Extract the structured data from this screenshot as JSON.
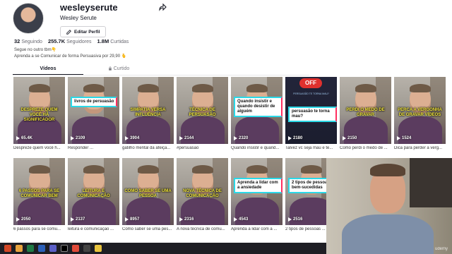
{
  "profile": {
    "username": "wesleyserute",
    "display_name": "Wesley Serute",
    "edit_label": "Editar Perfil",
    "following_count": "32",
    "following_label": "Seguindo",
    "followers_count": "255.7K",
    "followers_label": "Seguidores",
    "likes_count": "1.8M",
    "likes_label": "Curtidas",
    "bio_line1": "Segue no outro tbm👇",
    "bio_line2": "Aprenda a se Comunicar de forma Persuasiva por 29,90 🫰"
  },
  "tabs": [
    {
      "label": "Vídeos"
    },
    {
      "label": "Curtido"
    }
  ],
  "videos": [
    {
      "views": "65.4K",
      "desc": "Despreze quem você h...",
      "caption": "DESPREZE QUEM VOCÊ HÁ SIGNIFICADOR",
      "style": "yellow"
    },
    {
      "views": "2109",
      "desc": "Responder ...",
      "caption": "livros de persuasão",
      "style": "box"
    },
    {
      "views": "3904",
      "desc": "gatilho mental da afeiçã...",
      "caption": "SIMPATIA VERSA INFLUÊNCIA",
      "style": "yellow"
    },
    {
      "views": "2144",
      "desc": "#persuasão",
      "caption": "TÉCNICA DE PERSUASÃO",
      "style": "yellow"
    },
    {
      "views": "2320",
      "desc": "Quando insistir e quand...",
      "caption": "Quando insistir e quando desistir de alguém",
      "style": "box"
    },
    {
      "views": "2180",
      "desc": "Talvez vc seja mau e te...",
      "caption": "persuasão te torna mau?",
      "style": "dark",
      "badge": "OFF",
      "small_text": "PERSUASÃO TE TORNA MAU?"
    },
    {
      "views": "2150",
      "desc": "Como perdi o medo de ...",
      "caption": "PERDI O MEDO DE GRAVAR",
      "style": "yellow"
    },
    {
      "views": "1524",
      "desc": "Dica para perder a verg...",
      "caption": "PERCA A VERGONHA DE GRAVAR VÍDEOS",
      "style": "yellow"
    },
    {
      "views": "2050",
      "desc": "6 passos para se comu...",
      "caption": "6 PASSOS PARA SE COMUNICAR BEM",
      "style": "yellow"
    },
    {
      "views": "2137",
      "desc": "leitura e comunicação ...",
      "caption": "LEITURA E COMUNICAÇÃO",
      "style": "yellow"
    },
    {
      "views": "8957",
      "desc": "Como saber se uma pes...",
      "caption": "COMO SABER SE UMA PESSOA",
      "style": "yellow"
    },
    {
      "views": "2316",
      "desc": "A nova técnica de comu...",
      "caption": "NOVA TÉCNICA DE COMUNICAÇÃO",
      "style": "yellow"
    },
    {
      "views": "4543",
      "desc": "Aprenda a lidar com a ...",
      "caption": "Aprenda a lidar com a ansiedade",
      "style": "box"
    },
    {
      "views": "2516",
      "desc": "2 tipos de pessoas ...",
      "caption": "2 tipos de pessoas bem-sucedidas",
      "style": "box"
    }
  ],
  "webcam": {
    "watermark": "ūdemy"
  },
  "colors": {
    "accent_red": "#fe2c55",
    "caption_yellow": "#f2e63a",
    "box_cyan": "#2bd9e8",
    "box_pink": "#ff2e5f"
  },
  "icons": [
    "share-icon",
    "edit-icon",
    "lock-icon",
    "play-icon"
  ]
}
